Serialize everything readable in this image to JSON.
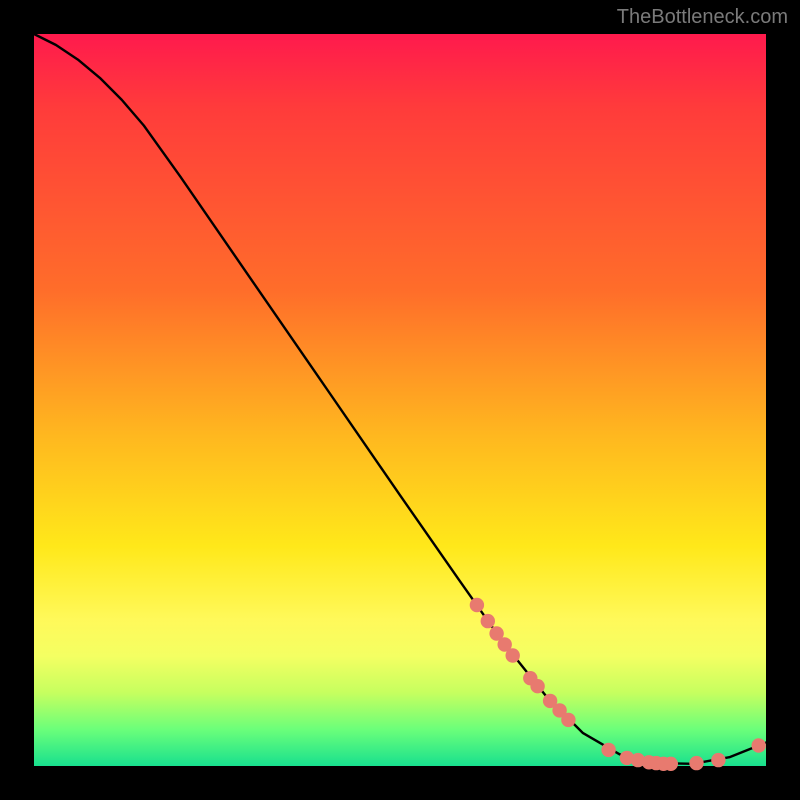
{
  "watermark": "TheBottleneck.com",
  "chart_data": {
    "type": "line",
    "title": "",
    "xlabel": "",
    "ylabel": "",
    "xlim": [
      0,
      100
    ],
    "ylim": [
      0,
      100
    ],
    "curve": [
      {
        "x": 0,
        "y": 100
      },
      {
        "x": 3,
        "y": 98.5
      },
      {
        "x": 6,
        "y": 96.5
      },
      {
        "x": 9,
        "y": 94
      },
      {
        "x": 12,
        "y": 91
      },
      {
        "x": 15,
        "y": 87.5
      },
      {
        "x": 20,
        "y": 80.5
      },
      {
        "x": 30,
        "y": 66
      },
      {
        "x": 40,
        "y": 51.5
      },
      {
        "x": 50,
        "y": 37
      },
      {
        "x": 58,
        "y": 25.5
      },
      {
        "x": 64,
        "y": 17
      },
      {
        "x": 70,
        "y": 9.5
      },
      {
        "x": 75,
        "y": 4.5
      },
      {
        "x": 80,
        "y": 1.6
      },
      {
        "x": 85,
        "y": 0.4
      },
      {
        "x": 90,
        "y": 0.3
      },
      {
        "x": 95,
        "y": 1.2
      },
      {
        "x": 100,
        "y": 3.2
      }
    ],
    "dots": [
      {
        "x": 60.5,
        "y": 22.0
      },
      {
        "x": 62.0,
        "y": 19.8
      },
      {
        "x": 63.2,
        "y": 18.1
      },
      {
        "x": 64.3,
        "y": 16.6
      },
      {
        "x": 65.4,
        "y": 15.1
      },
      {
        "x": 67.8,
        "y": 12.0
      },
      {
        "x": 68.8,
        "y": 10.9
      },
      {
        "x": 70.5,
        "y": 8.9
      },
      {
        "x": 71.8,
        "y": 7.6
      },
      {
        "x": 73.0,
        "y": 6.3
      },
      {
        "x": 78.5,
        "y": 2.2
      },
      {
        "x": 81.0,
        "y": 1.1
      },
      {
        "x": 82.5,
        "y": 0.8
      },
      {
        "x": 84.0,
        "y": 0.5
      },
      {
        "x": 85.0,
        "y": 0.4
      },
      {
        "x": 86.0,
        "y": 0.3
      },
      {
        "x": 87.0,
        "y": 0.3
      },
      {
        "x": 90.5,
        "y": 0.4
      },
      {
        "x": 93.5,
        "y": 0.8
      },
      {
        "x": 99.0,
        "y": 2.8
      }
    ],
    "dot_color": "#e87a6f"
  }
}
